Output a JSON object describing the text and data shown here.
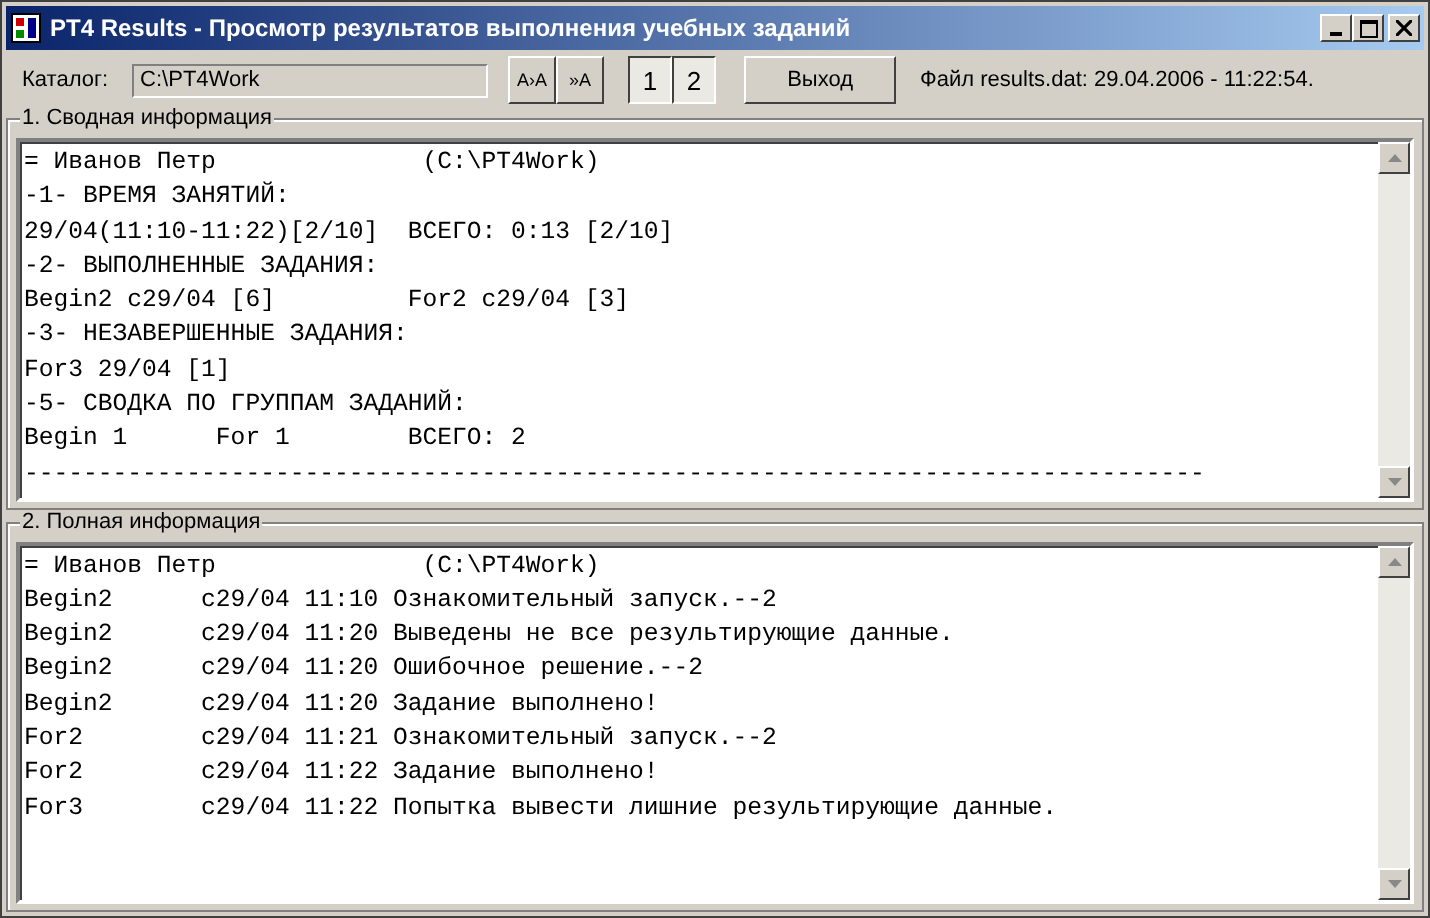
{
  "window": {
    "title": "PT4 Results - Просмотр результатов выполнения учебных заданий"
  },
  "toolbar": {
    "catalog_label": "Каталог:",
    "catalog_value": "C:\\PT4Work",
    "font_buttons": [
      "A›A",
      "»A"
    ],
    "toggles": [
      {
        "label": "1",
        "selected": true
      },
      {
        "label": "2",
        "selected": true
      }
    ],
    "exit_button": "Выход",
    "file_info": "Файл results.dat: 29.04.2006 - 11:22:54."
  },
  "panels": [
    {
      "title": "1. Сводная информация",
      "lines": [
        "= Иванов Петр              (C:\\PT4Work)",
        "-1- ВРЕМЯ ЗАНЯТИЙ:",
        "29/04(11:10-11:22)[2/10]  ВСЕГО: 0:13 [2/10]",
        "-2- ВЫПОЛНЕННЫЕ ЗАДАНИЯ:",
        "Begin2 c29/04 [6]         For2 c29/04 [3]",
        "-3- НЕЗАВЕРШЕННЫЕ ЗАДАНИЯ:",
        "For3 29/04 [1]",
        "-5- СВОДКА ПО ГРУППАМ ЗАДАНИЙ:",
        "Begin 1      For 1        ВСЕГО: 2",
        "--------------------------------------------------------------------------------"
      ]
    },
    {
      "title": "2. Полная информация",
      "lines": [
        "= Иванов Петр              (C:\\PT4Work)",
        "Begin2      c29/04 11:10 Ознакомительный запуск.--2",
        "Begin2      c29/04 11:20 Выведены не все результирующие данные.",
        "Begin2      c29/04 11:20 Ошибочное решение.--2",
        "Begin2      c29/04 11:20 Задание выполнено!",
        "For2        c29/04 11:21 Ознакомительный запуск.--2",
        "For2        c29/04 11:22 Задание выполнено!",
        "For3        c29/04 11:22 Попытка вывести лишние результирующие данные."
      ]
    }
  ]
}
